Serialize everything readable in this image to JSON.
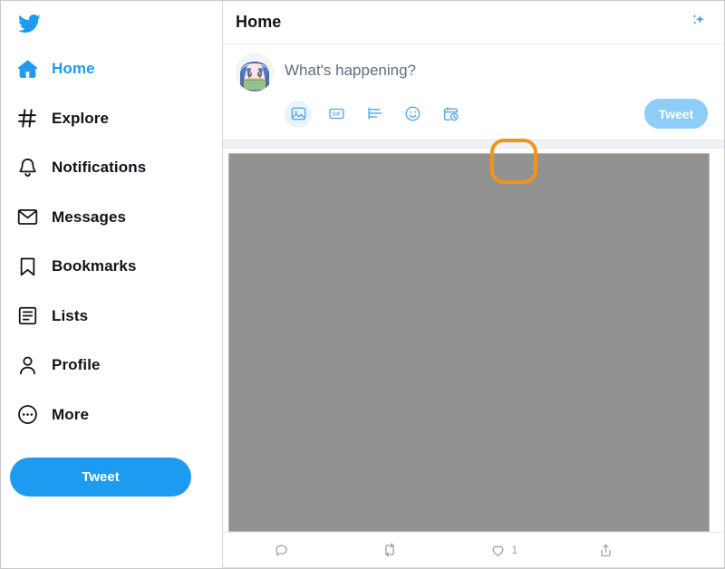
{
  "colors": {
    "brand_blue": "#1d9bf0",
    "highlight_orange": "#f0941e",
    "text_dark": "#0f1419",
    "text_muted": "#5b7083",
    "media_gray": "#929292",
    "tweet_btn_disabled": "#8ecdf7"
  },
  "sidebar": {
    "logo_icon": "twitter-bird-icon",
    "items": [
      {
        "label": "Home",
        "icon": "home-icon",
        "active": true
      },
      {
        "label": "Explore",
        "icon": "hashtag-icon",
        "active": false
      },
      {
        "label": "Notifications",
        "icon": "bell-icon",
        "active": false
      },
      {
        "label": "Messages",
        "icon": "envelope-icon",
        "active": false
      },
      {
        "label": "Bookmarks",
        "icon": "bookmark-icon",
        "active": false
      },
      {
        "label": "Lists",
        "icon": "list-icon",
        "active": false
      },
      {
        "label": "Profile",
        "icon": "person-icon",
        "active": false
      },
      {
        "label": "More",
        "icon": "more-ellipsis-icon",
        "active": false
      }
    ],
    "tweet_button": "Tweet"
  },
  "header": {
    "title": "Home",
    "sparkle_icon": "sparkle-icon"
  },
  "compose": {
    "avatar_icon": "user-avatar",
    "placeholder": "What's happening?",
    "tweet_button": "Tweet",
    "actions": [
      {
        "name": "media-icon",
        "label": "Media",
        "selected": true,
        "highlighted": true
      },
      {
        "name": "gif-icon",
        "label": "GIF",
        "selected": false,
        "highlighted": false
      },
      {
        "name": "poll-icon",
        "label": "Poll",
        "selected": false,
        "highlighted": false
      },
      {
        "name": "emoji-icon",
        "label": "Emoji",
        "selected": false,
        "highlighted": false
      },
      {
        "name": "schedule-icon",
        "label": "Schedule",
        "selected": false,
        "highlighted": false
      }
    ]
  },
  "media": {
    "placeholder_icon": "image-placeholder",
    "state": "gray-placeholder"
  },
  "tweet_actions": [
    {
      "icon": "reply-icon",
      "label": "Reply",
      "count": ""
    },
    {
      "icon": "retweet-icon",
      "label": "Retweet",
      "count": ""
    },
    {
      "icon": "like-icon",
      "label": "Like",
      "count": "1"
    },
    {
      "icon": "share-icon",
      "label": "Share",
      "count": ""
    }
  ]
}
